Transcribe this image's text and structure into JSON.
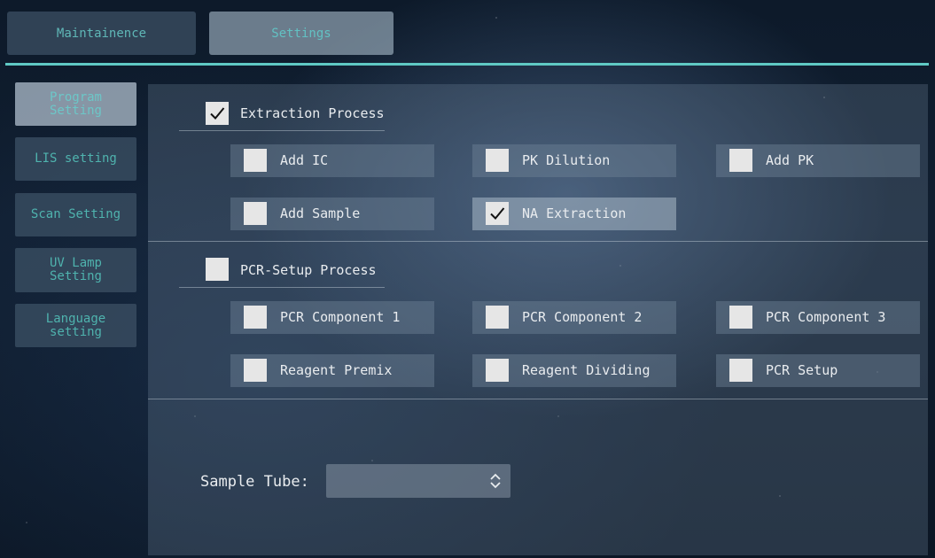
{
  "tabs": {
    "maintenance": "Maintainence",
    "settings": "Settings"
  },
  "sidebar": {
    "items": [
      {
        "label": "Program\nSetting",
        "active": true
      },
      {
        "label": "LIS setting",
        "active": false
      },
      {
        "label": "Scan Setting",
        "active": false
      },
      {
        "label": "UV Lamp\nSetting",
        "active": false
      },
      {
        "label": "Language\nsetting",
        "active": false
      }
    ]
  },
  "extraction": {
    "title": "Extraction Process",
    "checked": true,
    "options": [
      {
        "label": "Add IC",
        "checked": false
      },
      {
        "label": "PK Dilution",
        "checked": false
      },
      {
        "label": "Add PK",
        "checked": false
      },
      {
        "label": "Add Sample",
        "checked": false
      },
      {
        "label": "NA Extraction",
        "checked": true
      }
    ]
  },
  "pcr": {
    "title": "PCR-Setup Process",
    "checked": false,
    "options": [
      {
        "label": "PCR Component 1",
        "checked": false
      },
      {
        "label": "PCR Component 2",
        "checked": false
      },
      {
        "label": "PCR Component 3",
        "checked": false
      },
      {
        "label": "Reagent Premix",
        "checked": false
      },
      {
        "label": "Reagent Dividing",
        "checked": false
      },
      {
        "label": "PCR Setup",
        "checked": false
      }
    ]
  },
  "sample_tube": {
    "label": "Sample Tube:",
    "value": ""
  },
  "icons": {
    "check": "checkmark-icon",
    "select_arrows": "up-down-arrows-icon"
  },
  "colors": {
    "accent": "#5fc9c4",
    "tab_text": "#5fb7b7"
  }
}
